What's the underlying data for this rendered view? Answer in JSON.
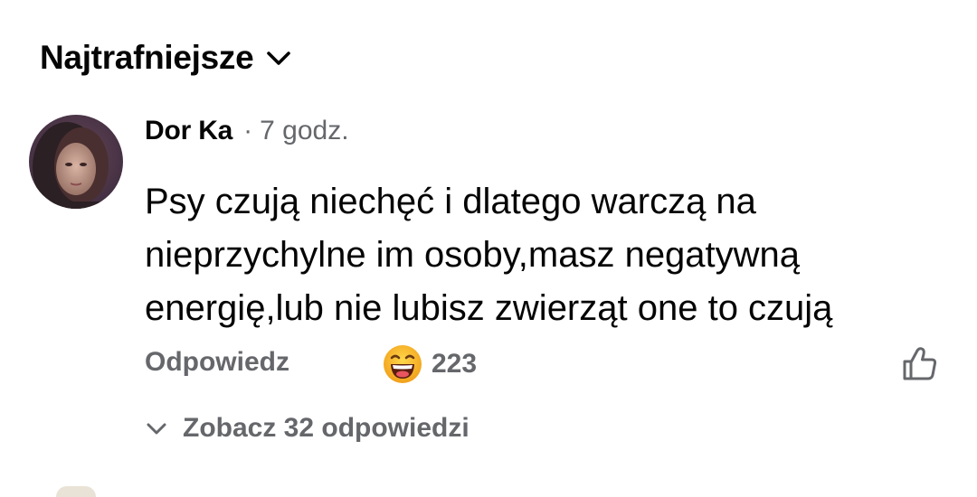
{
  "sort": {
    "label": "Najtrafniejsze",
    "icon": "chevron-down-icon"
  },
  "comment": {
    "author": "Dor Ka",
    "separator": "·",
    "time": "7 godz.",
    "text": "Psy czują niechęć i dlatego warczą na nieprzychylne im osoby,masz negatywną energię,lub nie lubisz zwierząt one to czują",
    "avatar_icon": "avatar",
    "actions": {
      "reply_label": "Odpowiedz",
      "reaction_icon": "laughing-emoji-icon",
      "reaction_count": "223",
      "like_icon": "thumbs-up-icon"
    },
    "view_replies": {
      "label": "Zobacz 32 odpowiedzi",
      "icon": "chevron-down-icon"
    }
  },
  "colors": {
    "primary_text": "#050505",
    "secondary_text": "#65676b",
    "background": "#ffffff",
    "emoji_face": "#f7b125"
  }
}
